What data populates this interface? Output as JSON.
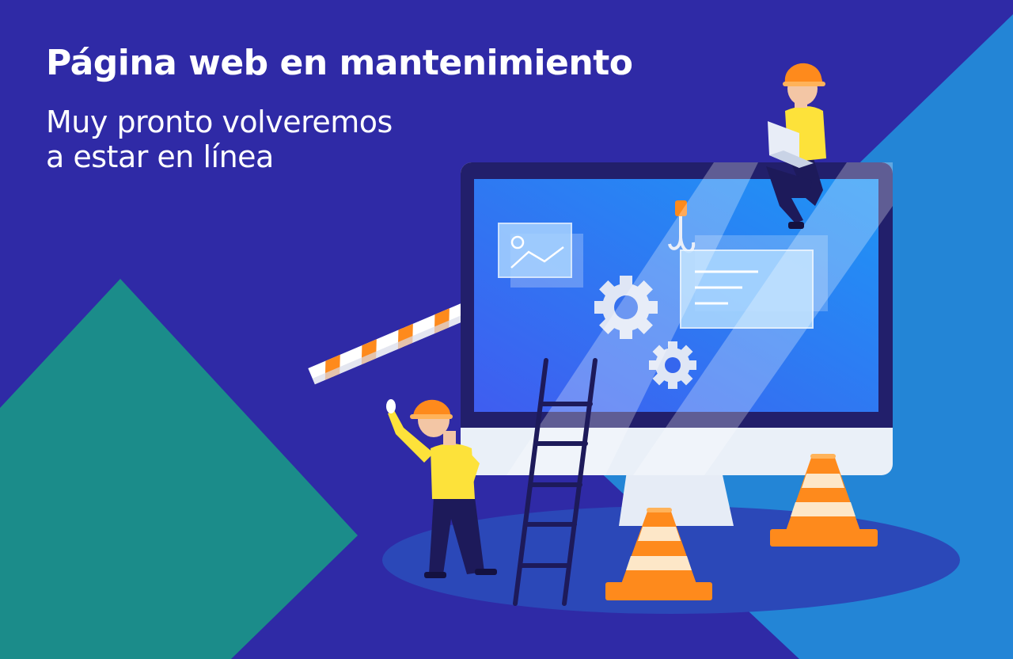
{
  "heading": {
    "title": "Página web en mantenimiento",
    "subtitle_line1": "Muy pronto volveremos",
    "subtitle_line2": "a estar en línea"
  },
  "colors": {
    "background": "#2f2aa6",
    "accent_teal": "#1b8c8a",
    "accent_blue": "#2385d6",
    "monitor_screen": "#3577f0",
    "safety_orange": "#fe8a1c",
    "worker_shirt": "#fde23a",
    "text": "#ffffff"
  },
  "illustration": {
    "icons": [
      "image-icon",
      "gear-icon",
      "crane-hook-icon",
      "document-icon"
    ],
    "characters": [
      "worker-waving",
      "worker-with-laptop"
    ]
  }
}
